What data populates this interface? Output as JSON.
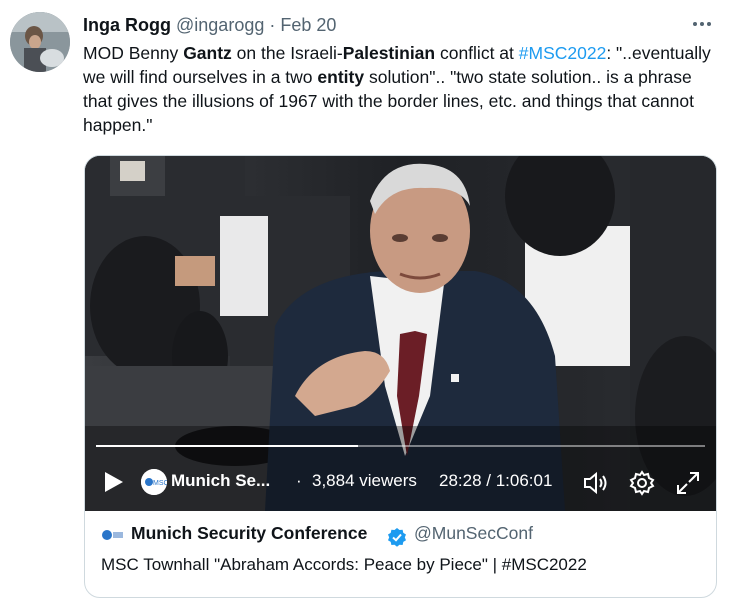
{
  "tweet": {
    "author_name": "Inga Rogg",
    "author_handle": "@ingarogg",
    "separator": "·",
    "date": "Feb 20",
    "text_runs": [
      {
        "t": "MOD Benny ",
        "s": "normal"
      },
      {
        "t": "Gantz",
        "s": "bold"
      },
      {
        "t": " on the Israeli-",
        "s": "normal"
      },
      {
        "t": "Palestinian",
        "s": "bold"
      },
      {
        "t": " conflict at ",
        "s": "normal"
      },
      {
        "t": "#MSC2022",
        "s": "hashtag"
      },
      {
        "t": ": \"..eventually we will find ourselves in a two ",
        "s": "normal"
      },
      {
        "t": "entity",
        "s": "bold"
      },
      {
        "t": " solution\".. \"two state solution.. is a phrase that gives the illusions of 1967 with the border lines, etc. and things that cannot happen.\"",
        "s": "normal"
      }
    ]
  },
  "video": {
    "channel_name": "Munich Se...",
    "dot": "·",
    "viewers": "3,884 viewers",
    "time": "28:28 / 1:06:01",
    "progress": 0.43
  },
  "card": {
    "channel": "Munich Security Conference",
    "handle": "@MunSecConf",
    "title": "MSC Townhall \"Abraham Accords: Peace by Piece\" | #MSC2022"
  },
  "icons": {
    "more": "more-icon",
    "play": "play-icon",
    "volume": "volume-icon",
    "settings": "settings-icon",
    "fullscreen": "fullscreen-icon",
    "verified": "verified-badge-icon"
  },
  "colors": {
    "accent": "#1d9bf0",
    "muted": "#536471",
    "text": "#0f1419"
  }
}
